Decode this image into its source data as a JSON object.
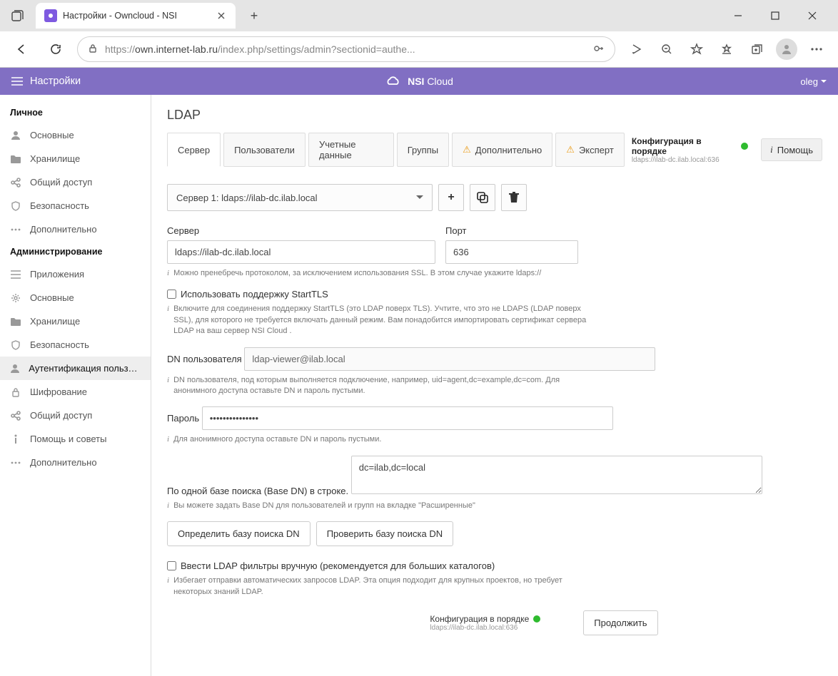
{
  "browser": {
    "tab_title": "Настройки - Owncloud - NSI",
    "url_prefix": "https://",
    "url_host": "own.internet-lab.ru",
    "url_path": "/index.php/settings/admin?sectionid=authe..."
  },
  "header": {
    "title": "Настройки",
    "brand_bold": "NSI",
    "brand_light": "Cloud",
    "user": "oleg"
  },
  "sidebar": {
    "section1": "Личное",
    "personal": [
      {
        "label": "Основные",
        "icon": "user"
      },
      {
        "label": "Хранилище",
        "icon": "folder"
      },
      {
        "label": "Общий доступ",
        "icon": "share"
      },
      {
        "label": "Безопасность",
        "icon": "shield"
      },
      {
        "label": "Дополнительно",
        "icon": "dots"
      }
    ],
    "section2": "Администрирование",
    "admin": [
      {
        "label": "Приложения",
        "icon": "lines"
      },
      {
        "label": "Основные",
        "icon": "gear"
      },
      {
        "label": "Хранилище",
        "icon": "folder"
      },
      {
        "label": "Безопасность",
        "icon": "shield"
      },
      {
        "label": "Аутентификация пользоват...",
        "icon": "user"
      },
      {
        "label": "Шифрование",
        "icon": "lock"
      },
      {
        "label": "Общий доступ",
        "icon": "share"
      },
      {
        "label": "Помощь и советы",
        "icon": "info"
      },
      {
        "label": "Дополнительно",
        "icon": "dots"
      }
    ]
  },
  "page": {
    "title": "LDAP",
    "tabs": [
      "Сервер",
      "Пользователи",
      "Учетные данные",
      "Группы",
      "Дополнительно",
      "Эксперт"
    ],
    "status_label": "Конфигурация в порядке",
    "status_sub": "ldaps://ilab-dc.ilab.local:636",
    "help": "Помощь",
    "server_select": "Сервер 1: ldaps://ilab-dc.ilab.local",
    "labels": {
      "server": "Сервер",
      "port": "Порт",
      "user_dn": "DN пользователя",
      "password": "Пароль",
      "base_dn": "По одной базе поиска (Base DN) в строке."
    },
    "values": {
      "server": "ldaps://ilab-dc.ilab.local",
      "port": "636",
      "user_dn": "ldap-viewer@ilab.local",
      "password": "•••••••••••••••",
      "base_dn": "dc=ilab,dc=local"
    },
    "hints": {
      "server": "Можно пренебречь протоколом, за исключением использования SSL. В этом случае укажите ldaps://",
      "starttls": "Включите для соединения поддержку StartTLS (это LDAP поверх TLS). Учтите, что это не LDAPS (LDAP поверх SSL), для которого не требуется включать данный режим. Вам понадобится импортировать сертификат сервера LDAP на ваш сервер NSI Cloud .",
      "user_dn": "DN пользователя, под которым выполняется подключение, например, uid=agent,dc=example,dc=com. Для анонимного доступа оставьте DN и пароль пустыми.",
      "password": "Для анонимного доступа оставьте DN и пароль пустыми.",
      "base_dn": "Вы можете задать Base DN для пользователей и групп на вкладке \"Расширенные\"",
      "manual": "Избегает отправки автоматических запросов LDAP. Эта опция подходит для крупных проектов, но требует некоторых знаний LDAP."
    },
    "checkboxes": {
      "starttls": "Использовать поддержку StartTLS",
      "manual": "Ввести LDAP фильтры вручную (рекомендуется для больших каталогов)"
    },
    "buttons": {
      "detect": "Определить базу поиска DN",
      "test": "Проверить базу поиска DN",
      "continue": "Продолжить"
    }
  }
}
